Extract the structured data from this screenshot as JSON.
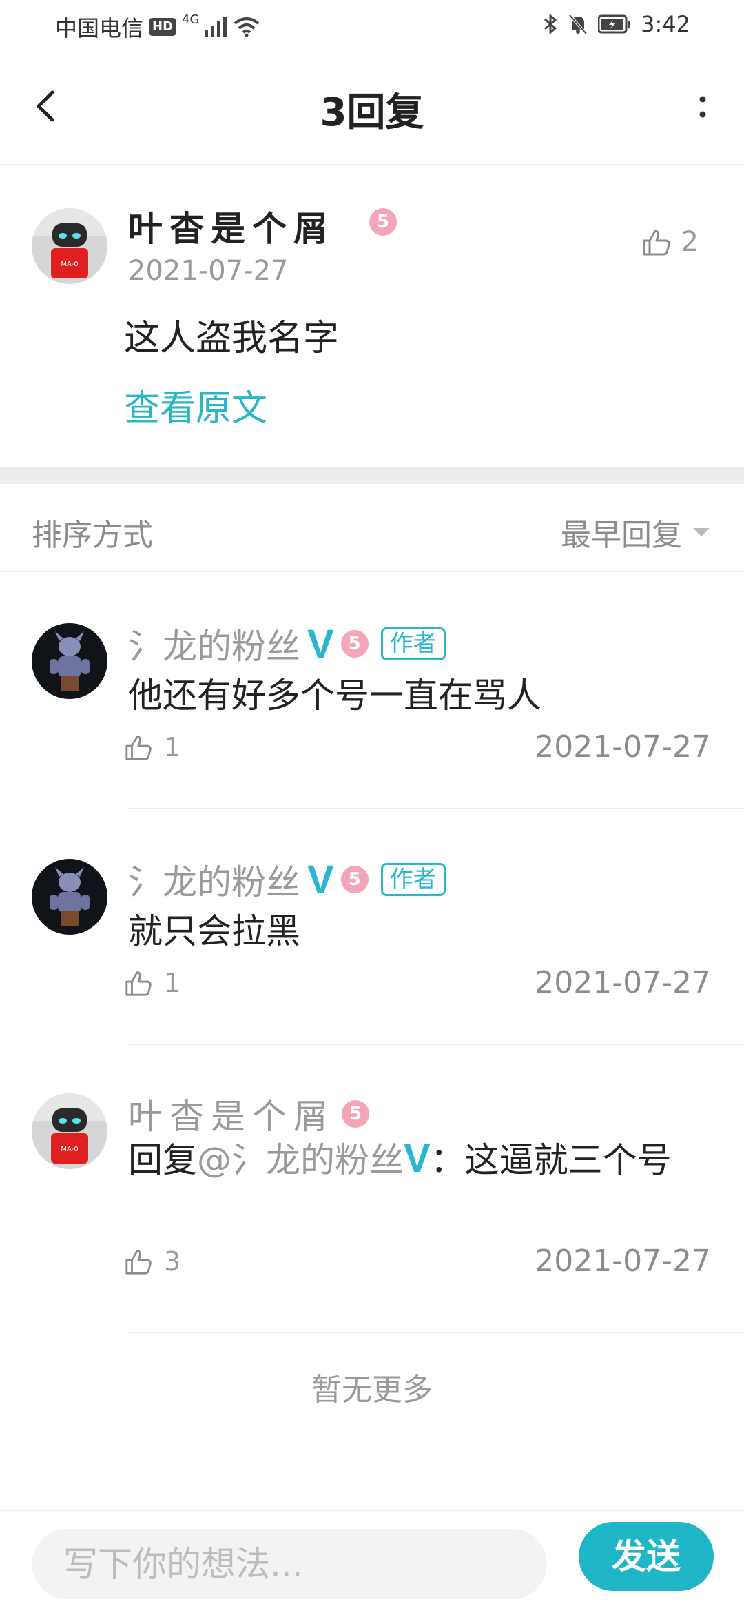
{
  "status_bar": {
    "carrier": "中国电信",
    "hd": "HD",
    "network": "4G",
    "time": "3:42"
  },
  "header": {
    "title": "3回复"
  },
  "main_post": {
    "username": "叶杳是个屑",
    "level": "5",
    "date": "2021-07-27",
    "likes": "2",
    "content": "这人盗我名字",
    "view_original": "查看原文"
  },
  "sort": {
    "label": "排序方式",
    "selected": "最早回复"
  },
  "replies": [
    {
      "username": "氵龙的粉丝",
      "vip": "V",
      "level": "5",
      "tag": "作者",
      "content": "他还有好多个号一直在骂人",
      "likes": "1",
      "date": "2021-07-27"
    },
    {
      "username": "氵龙的粉丝",
      "vip": "V",
      "level": "5",
      "tag": "作者",
      "content": "就只会拉黑",
      "likes": "1",
      "date": "2021-07-27"
    },
    {
      "username": "叶杳是个屑",
      "level": "5",
      "reply_prefix": "回复",
      "mention": "@氵龙的粉丝",
      "vip": "V",
      "content": "：这逼就三个号",
      "likes": "3",
      "date": "2021-07-27"
    }
  ],
  "no_more": "暂无更多",
  "bottom": {
    "input_placeholder": "写下你的想法...",
    "send_label": "发送"
  },
  "colors": {
    "accent": "#2bb6c7",
    "level_badge": "#f4a6b8",
    "send_button": "#1fb6c8"
  },
  "icons": {
    "back": "chevron-left-icon",
    "more": "more-vertical-icon",
    "like": "thumbs-up-icon",
    "bluetooth": "bluetooth-icon",
    "mute": "bell-off-icon",
    "battery": "battery-icon",
    "wifi": "wifi-icon",
    "signal": "signal-icon"
  }
}
